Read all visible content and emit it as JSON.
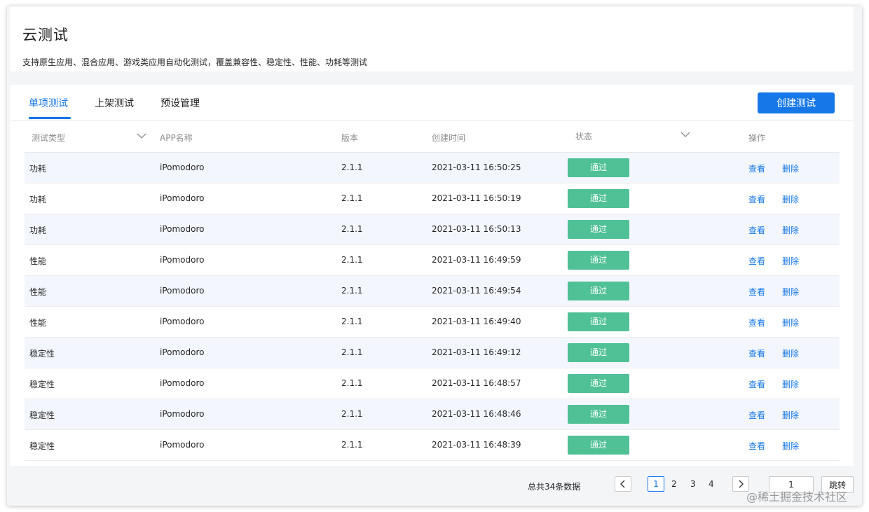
{
  "header": {
    "title": "云测试",
    "description": "支持原生应用、混合应用、游戏类应用自动化测试，覆盖兼容性、稳定性、性能、功耗等测试"
  },
  "tabs": [
    {
      "label": "单项测试",
      "active": true
    },
    {
      "label": "上架测试",
      "active": false
    },
    {
      "label": "预设管理",
      "active": false
    }
  ],
  "create_button": "创建测试",
  "table": {
    "columns": {
      "type": "测试类型",
      "app": "APP名称",
      "version": "版本",
      "created": "创建时间",
      "status": "状态",
      "actions": "操作"
    },
    "rows": [
      {
        "type": "功耗",
        "app": "iPomodoro",
        "version": "2.1.1",
        "created": "2021-03-11 16:50:25",
        "status": "通过",
        "view": "查看",
        "delete": "删除"
      },
      {
        "type": "功耗",
        "app": "iPomodoro",
        "version": "2.1.1",
        "created": "2021-03-11 16:50:19",
        "status": "通过",
        "view": "查看",
        "delete": "删除"
      },
      {
        "type": "功耗",
        "app": "iPomodoro",
        "version": "2.1.1",
        "created": "2021-03-11 16:50:13",
        "status": "通过",
        "view": "查看",
        "delete": "删除"
      },
      {
        "type": "性能",
        "app": "iPomodoro",
        "version": "2.1.1",
        "created": "2021-03-11 16:49:59",
        "status": "通过",
        "view": "查看",
        "delete": "删除"
      },
      {
        "type": "性能",
        "app": "iPomodoro",
        "version": "2.1.1",
        "created": "2021-03-11 16:49:54",
        "status": "通过",
        "view": "查看",
        "delete": "删除"
      },
      {
        "type": "性能",
        "app": "iPomodoro",
        "version": "2.1.1",
        "created": "2021-03-11 16:49:40",
        "status": "通过",
        "view": "查看",
        "delete": "删除"
      },
      {
        "type": "稳定性",
        "app": "iPomodoro",
        "version": "2.1.1",
        "created": "2021-03-11 16:49:12",
        "status": "通过",
        "view": "查看",
        "delete": "删除"
      },
      {
        "type": "稳定性",
        "app": "iPomodoro",
        "version": "2.1.1",
        "created": "2021-03-11 16:48:57",
        "status": "通过",
        "view": "查看",
        "delete": "删除"
      },
      {
        "type": "稳定性",
        "app": "iPomodoro",
        "version": "2.1.1",
        "created": "2021-03-11 16:48:46",
        "status": "通过",
        "view": "查看",
        "delete": "删除"
      },
      {
        "type": "稳定性",
        "app": "iPomodoro",
        "version": "2.1.1",
        "created": "2021-03-11 16:48:39",
        "status": "通过",
        "view": "查看",
        "delete": "删除"
      }
    ]
  },
  "pagination": {
    "total_text": "总共34条数据",
    "pages": [
      "1",
      "2",
      "3",
      "4"
    ],
    "current_page": "1",
    "jump_value": "1",
    "jump_label": "跳转"
  },
  "watermark": "@稀土掘金技术社区",
  "colors": {
    "accent": "#1677e8",
    "status_pass": "#50c196",
    "row_alt": "#f3f7fd"
  },
  "icons": {
    "column_filter": "chevron-down-icon",
    "prev": "chevron-left-icon",
    "next": "chevron-right-icon"
  }
}
